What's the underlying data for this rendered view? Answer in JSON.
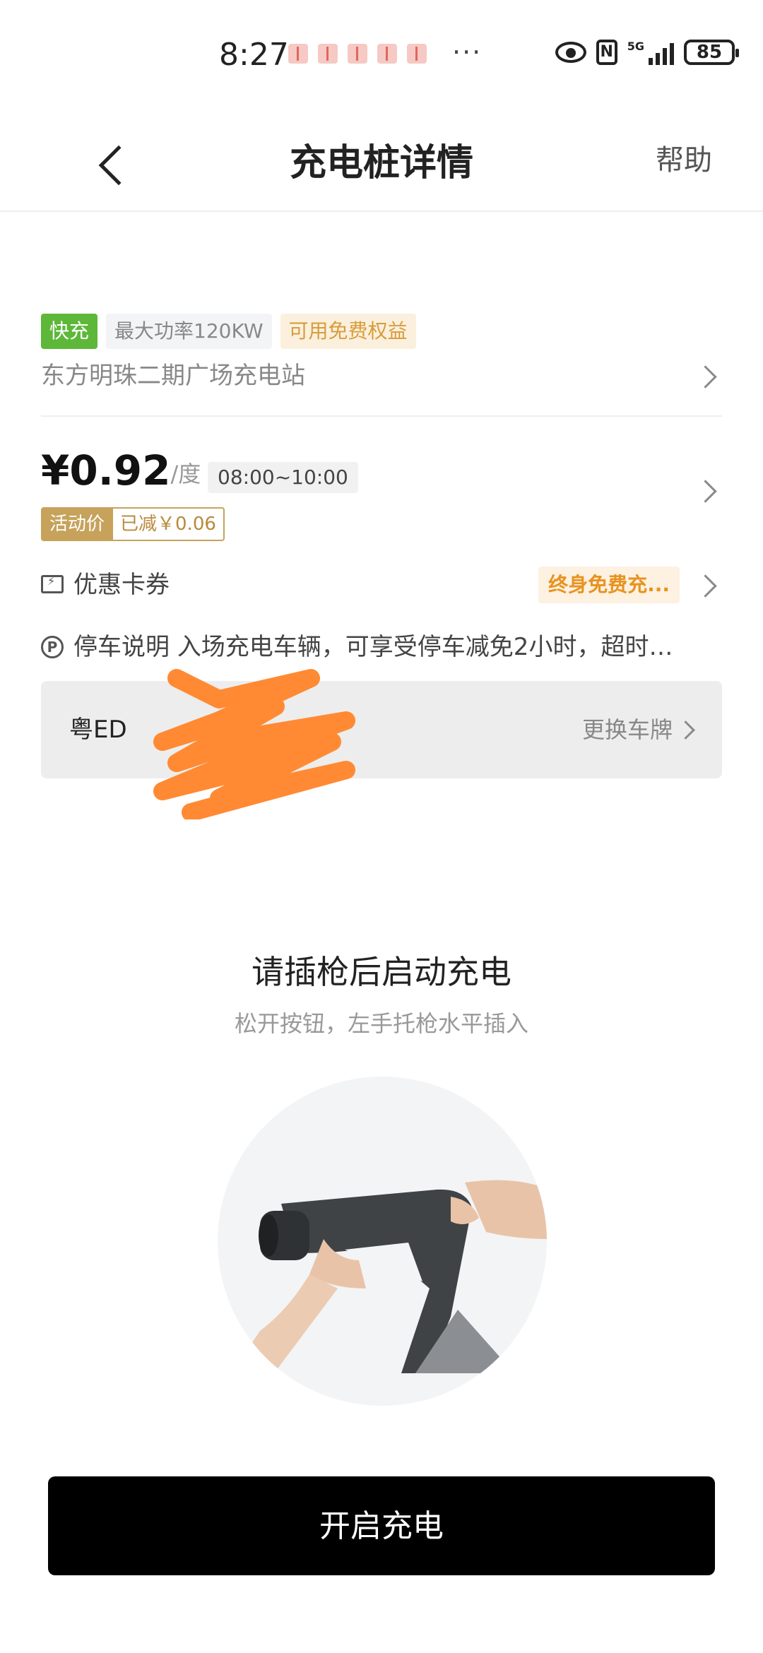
{
  "status_bar": {
    "time": "8:27",
    "more": "···",
    "nfc": "N",
    "network": "5G",
    "battery": "85"
  },
  "header": {
    "title": "充电桩详情",
    "help": "帮助"
  },
  "station": {
    "tags": {
      "fast": "快充",
      "power": "最大功率120KW",
      "free": "可用免费权益"
    },
    "name": "东方明珠二期广场充电站"
  },
  "price": {
    "value": "¥0.92",
    "unit": "/度",
    "time_range": "08:00~10:00",
    "promo_label": "活动价",
    "promo_reduce": "已减￥0.06"
  },
  "coupon": {
    "label": "优惠卡券",
    "badge": "终身免费充..."
  },
  "parking": {
    "icon_letter": "P",
    "text": "停车说明  入场充电车辆，可享受停车减免2小时，超时…"
  },
  "plate": {
    "value": "粤ED",
    "change": "更换车牌"
  },
  "plug": {
    "title": "请插枪后启动充电",
    "subtitle": "松开按钮，左手托枪水平插入"
  },
  "action": {
    "start": "开启充电"
  },
  "colors": {
    "fast_tag": "#5db839",
    "free_tag_text": "#d89c3b",
    "promo_gold": "#c6a25b",
    "coupon_orange": "#e8931f",
    "scribble": "#ff8a33"
  }
}
